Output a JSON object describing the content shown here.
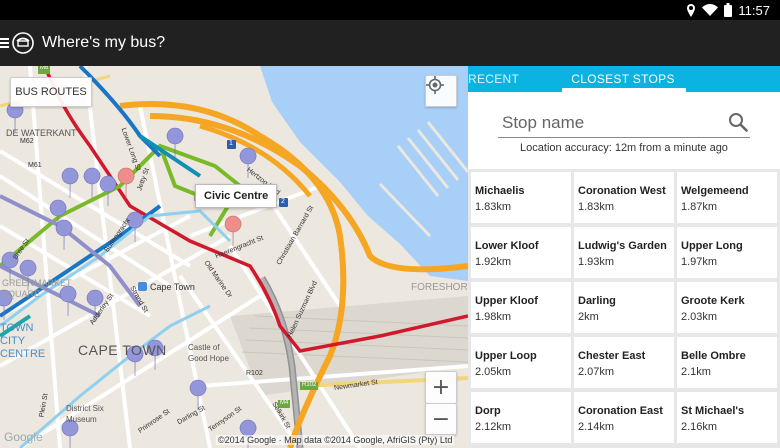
{
  "statusbar": {
    "time": "11:57",
    "icons": [
      "location-icon",
      "wifi-icon",
      "battery-icon"
    ]
  },
  "appbar": {
    "title": "Where's my bus?",
    "icons": [
      "menu-icon",
      "bus-logo-icon"
    ]
  },
  "map": {
    "bus_routes_label": "BUS ROUTES",
    "callout": "Civic Centre",
    "zoom_in": "+",
    "zoom_out": "−",
    "copyright": "©2014 Google · Map data ©2014 Google, AfriGIS (Pty) Ltd",
    "google_logo": "Google",
    "labels": {
      "dewaterkant": "DE WATERKANT",
      "cape_town_big": "CAPE TOWN",
      "cape_town_station": "Cape Town",
      "castle": "Castle of Good Hope",
      "district_six": "District Six Museum",
      "foreshore": "FORESHORE",
      "greenmarket": "GREENMARKET SQUARE",
      "city_centre": "TOWN CITY CENTRE",
      "buitengracht": "Buitengracht",
      "bree": "Bree St",
      "adderley": "Adderley St",
      "strand": "Strand St",
      "heerengracht": "Heerengracht St",
      "hertzog": "Hertzog Blvd",
      "lower_long": "Lower Long St",
      "old_marine": "Old Marine Dr",
      "christiaan_barnard": "Christiaan Barnard St",
      "helen_suzman": "Helen Suzman Blvd",
      "newmarket": "Newmarket St",
      "selkirk": "Selkirk St",
      "darling": "Darling St",
      "plein": "Plein St",
      "primrose": "Primrose St",
      "tennyson": "Tennyson St",
      "jetty": "Jetty St",
      "roads": [
        "M6",
        "M62",
        "M61",
        "M4",
        "R102",
        "R102",
        "M4",
        "1",
        "2"
      ]
    },
    "colors": {
      "water": "#a8cff7",
      "land": "#ece7df",
      "orange_route": "#f5a623",
      "red_route": "#d0192d",
      "green_route": "#7ab929",
      "blue_route": "#1976c5",
      "lightblue_route": "#8fd0ef",
      "purple_route": "#8f8fc9",
      "pin": "#9496da",
      "pin_selected": "#ee8d8a"
    }
  },
  "panel": {
    "tabs": [
      {
        "label": "RECENT",
        "active": false
      },
      {
        "label": "CLOSEST STOPS",
        "active": true
      }
    ],
    "search_placeholder": "Stop name",
    "accuracy": "Location accuracy: 12m from a minute ago",
    "stops": [
      {
        "name": "Michaelis",
        "distance": "1.83km"
      },
      {
        "name": "Coronation West",
        "distance": "1.83km"
      },
      {
        "name": "Welgemeend",
        "distance": "1.87km"
      },
      {
        "name": "Lower Kloof",
        "distance": "1.92km"
      },
      {
        "name": "Ludwig's Garden",
        "distance": "1.93km"
      },
      {
        "name": "Upper Long",
        "distance": "1.97km"
      },
      {
        "name": "Upper Kloof",
        "distance": "1.98km"
      },
      {
        "name": "Darling",
        "distance": "2km"
      },
      {
        "name": "Groote Kerk",
        "distance": "2.03km"
      },
      {
        "name": "Upper Loop",
        "distance": "2.05km"
      },
      {
        "name": "Chester East",
        "distance": "2.07km"
      },
      {
        "name": "Belle Ombre",
        "distance": "2.1km"
      },
      {
        "name": "Dorp",
        "distance": "2.12km"
      },
      {
        "name": "Coronation East",
        "distance": "2.14km"
      },
      {
        "name": "St Michael's",
        "distance": "2.16km"
      }
    ]
  }
}
